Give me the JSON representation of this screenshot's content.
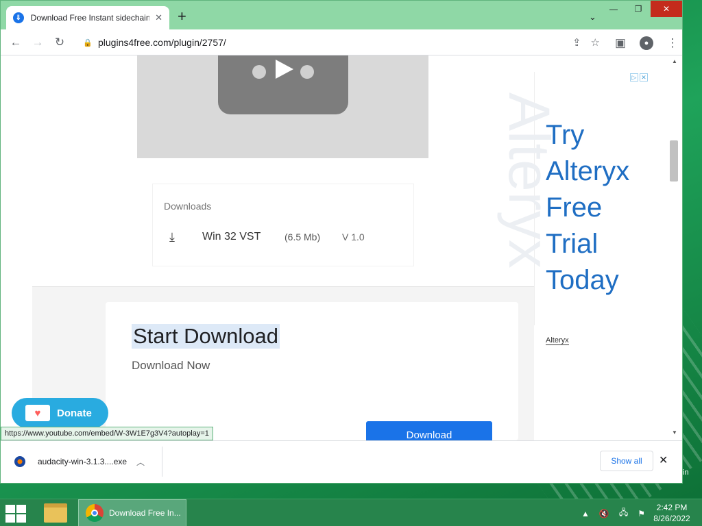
{
  "browser": {
    "tab_title": "Download Free Instant sidechain",
    "tab_favicon": "plugins4free-icon",
    "new_tab_icon": "+",
    "url": "plugins4free.com/plugin/2757/",
    "window_controls": [
      "—",
      "❐",
      "✕"
    ]
  },
  "page": {
    "downloads_heading": "Downloads",
    "download_item": {
      "name": "Win 32 VST",
      "size": "(6.5 Mb)",
      "version": "V 1.0"
    },
    "start_title": "Start Download",
    "start_subtitle": "Download Now",
    "download_button": "Download",
    "donate_label": "Donate",
    "status_url": "https://www.youtube.com/embed/W-3W1E7g3V4?autoplay=1"
  },
  "ad": {
    "text_lines": [
      "Try",
      "Alteryx",
      "Free",
      "Trial",
      "Today"
    ],
    "watermark": "Alteryx",
    "brand": "Alteryx"
  },
  "download_bar": {
    "file_name": "audacity-win-3.1.3....exe",
    "show_all": "Show all"
  },
  "taskbar": {
    "task_label": "Download Free In...",
    "time": "2:42 PM",
    "date": "8/26/2022",
    "desktop_edge_text": "in"
  },
  "colors": {
    "accent": "#1a73e8",
    "ad_text": "#1f6ec3",
    "donate": "#29abe0",
    "tab_strip": "#8fd8a6"
  }
}
